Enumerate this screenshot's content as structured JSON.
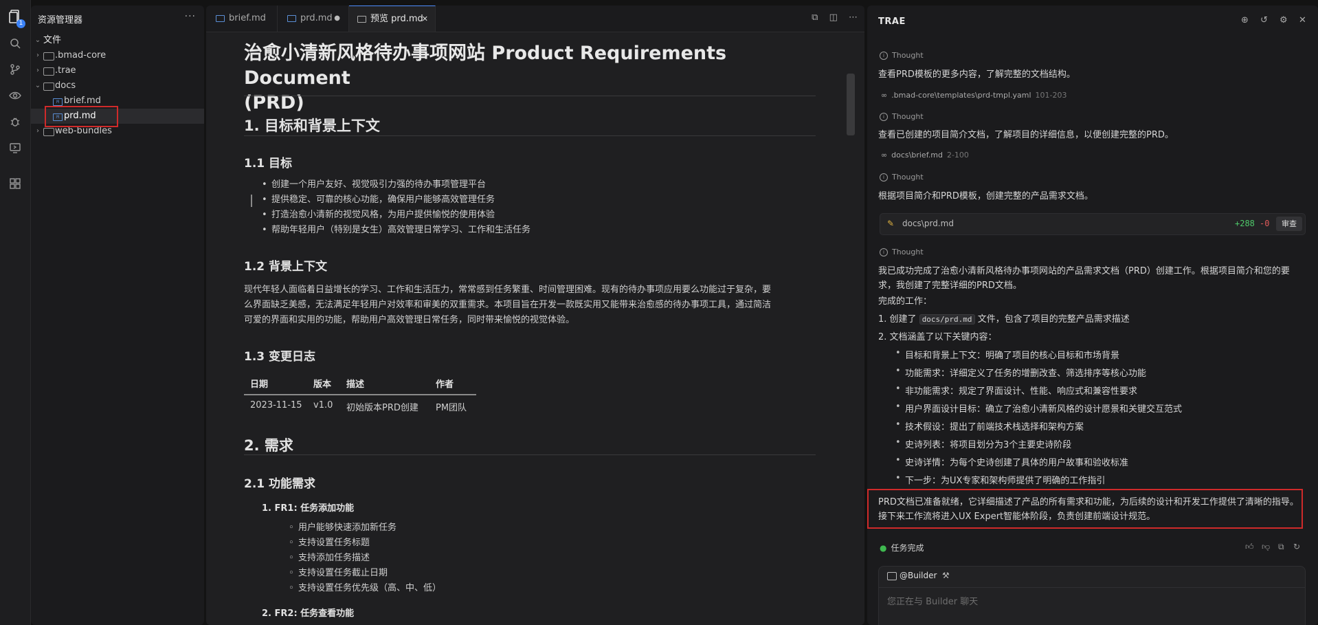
{
  "activity": {
    "badge": "1"
  },
  "explorer": {
    "title": "资源管理器",
    "more": "···",
    "section": "文件",
    "items": [
      {
        "label": ".bmad-core"
      },
      {
        "label": ".trae"
      },
      {
        "label": "docs"
      },
      {
        "label": "brief.md"
      },
      {
        "label": "prd.md"
      },
      {
        "label": "web-bundles"
      }
    ]
  },
  "editor": {
    "tabs": [
      {
        "label": "brief.md"
      },
      {
        "label": "prd.md"
      },
      {
        "label": "预览 prd.md"
      }
    ],
    "tab_close": "✕",
    "doc": {
      "title_line1": "治愈小清新风格待办事项网站 Product Requirements Document",
      "title_line2": "(PRD)",
      "h_goals_bg": "1. 目标和背景上下文",
      "h_goals": "1.1 目标",
      "goals": [
        "创建一个用户友好、视觉吸引力强的待办事项管理平台",
        "提供稳定、可靠的核心功能，确保用户能够高效管理任务",
        "打造治愈小清新的视觉风格，为用户提供愉悦的使用体验",
        "帮助年轻用户（特别是女生）高效管理日常学习、工作和生活任务"
      ],
      "h_background": "1.2 背景上下文",
      "background_lines": [
        "现代年轻人面临着日益增长的学习、工作和生活压力，常常感到任务繁重、时间管理困难。现有的待办事项应用要么功能过于复杂，要",
        "么界面缺乏美感，无法满足年轻用户对效率和审美的双重需求。本项目旨在开发一款既实用又能带来治愈感的待办事项工具，通过简洁",
        "可爱的界面和实用的功能，帮助用户高效管理日常任务，同时带来愉悦的视觉体验。"
      ],
      "h_changelog": "1.3 变更日志",
      "changelog_headers": [
        "日期",
        "版本",
        "描述",
        "作者"
      ],
      "changelog_row": [
        "2023-11-15",
        "v1.0",
        "初始版本PRD创建",
        "PM团队"
      ],
      "h_requirements": "2. 需求",
      "h_functional": "2.1 功能需求",
      "fr1_title": "1. FR1: 任务添加功能",
      "fr1_items": [
        "用户能够快速添加新任务",
        "支持设置任务标题",
        "支持添加任务描述",
        "支持设置任务截止日期",
        "支持设置任务优先级（高、中、低）"
      ],
      "fr2_title": "2. FR2: 任务查看功能"
    }
  },
  "chat": {
    "title": "TRAE",
    "thought_label": "Thought",
    "msg1": "查看PRD模板的更多内容，了解完整的文档结构。",
    "ref1_path": ".bmad-core\\templates\\prd-tmpl.yaml",
    "ref1_range": "101-203",
    "msg2": "查看已创建的项目简介文档，了解项目的详细信息，以便创建完整的PRD。",
    "ref2_path": "docs\\brief.md",
    "ref2_range": "2-100",
    "msg3": "根据项目简介和PRD模板，创建完整的产品需求文档。",
    "diff_file": "docs\\prd.md",
    "diff_add": "+288",
    "diff_del": "-0",
    "review_btn": "审查",
    "summary_line1": "我已成功完成了治愈小清新风格待办事项网站的产品需求文档（PRD）创建工作。根据项目简介和您的要",
    "summary_line2": "求，我创建了完整详细的PRD文档。",
    "done_heading": "完成的工作：",
    "done1_prefix": "1. 创建了",
    "done1_code": "docs/prd.md",
    "done1_suffix": "文件，包含了项目的完整产品需求描述",
    "done2": "2. 文档涵盖了以下关键内容：",
    "bullets": [
      "目标和背景上下文：明确了项目的核心目标和市场背景",
      "功能需求：详细定义了任务的增删改查、筛选排序等核心功能",
      "非功能需求：规定了界面设计、性能、响应式和兼容性要求",
      "用户界面设计目标：确立了治愈小清新风格的设计愿景和关键交互范式",
      "技术假设：提出了前端技术栈选择和架构方案",
      "史诗列表：将项目划分为3个主要史诗阶段",
      "史诗详情：为每个史诗创建了具体的用户故事和验收标准",
      "下一步：为UX专家和架构师提供了明确的工作指引"
    ],
    "final_line1": "PRD文档已准备就绪，它详细描述了产品的所有需求和功能，为后续的设计和开发工作提供了清晰的指导。",
    "final_line2": "接下来工作流将进入UX Expert智能体阶段，负责创建前端设计规范。",
    "task_done": "任务完成",
    "builder_label": "@Builder",
    "input_placeholder": "您正在与 Builder 聊天"
  },
  "colors": {
    "accent": "#4c8dff",
    "diff_add": "#4ec96a",
    "diff_del": "#e05a5a",
    "highlight_border": "#d02a2a",
    "success": "#3fb950"
  }
}
